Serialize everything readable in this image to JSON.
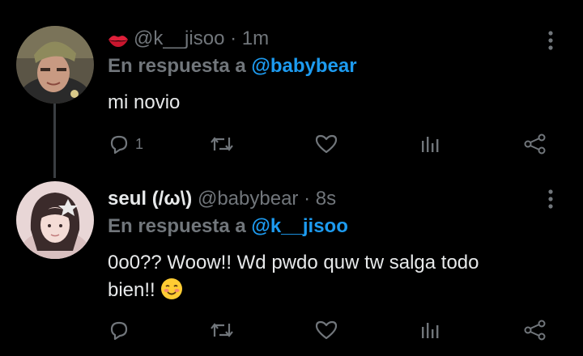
{
  "tweets": [
    {
      "display_name": "",
      "handle": "@k__jisoo",
      "time": "· 1m",
      "reply_prefix": "En respuesta a",
      "reply_to": "@babybear",
      "text": "mi novio",
      "reply_count": "1",
      "name_icon": "kiss-lips-icon"
    },
    {
      "display_name": "seul (/ω\\)",
      "handle": "@babybear",
      "time": "· 8s",
      "reply_prefix": "En respuesta a",
      "reply_to": "@k__jisoo",
      "text_line1": "0o0?? Woow!! Wd pwdo quw tw salga todo",
      "text_line2": "bien!!",
      "text_emoji": "smiling-face-with-blush-icon",
      "reply_count": ""
    }
  ],
  "actions": [
    "reply-icon",
    "retweet-icon",
    "like-icon",
    "analytics-icon",
    "share-icon"
  ],
  "colors": {
    "background": "#000000",
    "text": "#e7e9ea",
    "muted": "#71767b",
    "link": "#1d9bf0",
    "thread_line": "#3a3e42"
  }
}
